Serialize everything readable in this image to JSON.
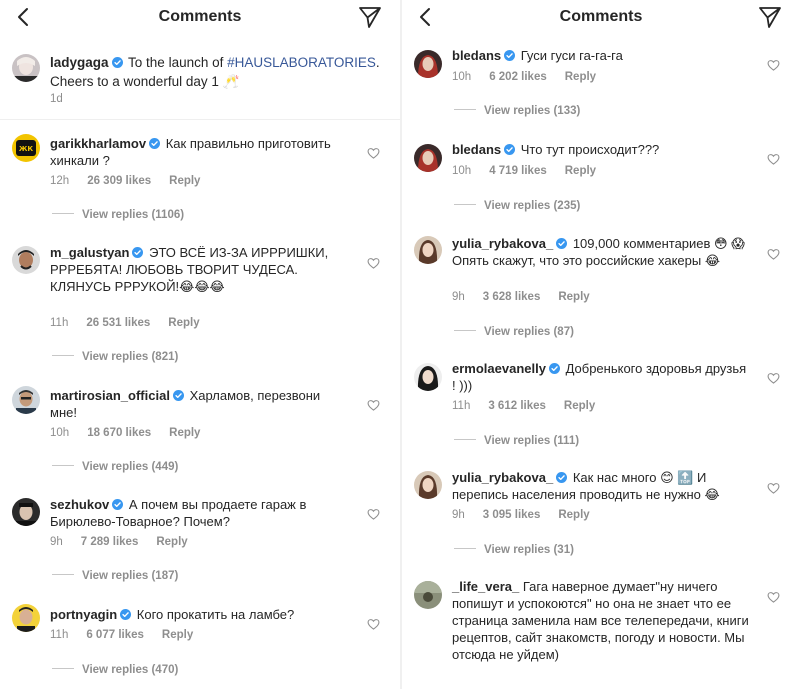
{
  "left": {
    "header": {
      "title": "Comments",
      "back_icon": "back-chevron-icon",
      "send_icon": "direct-send-icon"
    },
    "caption": {
      "username": "ladygaga",
      "text_before": " To the launch of ",
      "hashtag": "#HAUSLABORATORIES",
      "text_after": ". Cheers to a wonderful day 1 🥂",
      "time": "1d"
    },
    "comments": [
      {
        "username": "garikkharlamov",
        "text": "Как правильно приготовить хинкали ?",
        "time": "12h",
        "likes": "26 309 likes",
        "reply": "Reply",
        "view_replies": "View replies (1106)"
      },
      {
        "username": "m_galustyan",
        "text": "ЭТО ВСЁ ИЗ-ЗА ИРРРИШКИ, РРРЕБЯТА! ЛЮБОВЬ ТВОРИТ ЧУДЕСА. КЛЯНУСЬ РРРУКОЙ!😂😂😂",
        "time": "11h",
        "likes": "26 531 likes",
        "reply": "Reply",
        "view_replies": "View replies (821)"
      },
      {
        "username": "martirosian_official",
        "text": "Харламов, перезвони мне!",
        "time": "10h",
        "likes": "18 670 likes",
        "reply": "Reply",
        "view_replies": "View replies (449)"
      },
      {
        "username": "sezhukov",
        "text": "А почем вы продаете гараж в Бирюлево-Товарное? Почем?",
        "time": "9h",
        "likes": "7 289 likes",
        "reply": "Reply",
        "view_replies": "View replies (187)"
      },
      {
        "username": "portnyagin",
        "text": "Кого прокатить на ламбе?",
        "time": "11h",
        "likes": "6 077 likes",
        "reply": "Reply",
        "view_replies": "View replies (470)"
      }
    ]
  },
  "right": {
    "header": {
      "title": "Comments",
      "back_icon": "back-chevron-icon",
      "send_icon": "direct-send-icon"
    },
    "comments": [
      {
        "username": "bledans",
        "text": "Гуси гуси га-га-га",
        "time": "10h",
        "likes": "6 202 likes",
        "reply": "Reply",
        "view_replies": "View replies (133)"
      },
      {
        "username": "bledans",
        "text": "Что тут происходит???",
        "time": "10h",
        "likes": "4 719 likes",
        "reply": "Reply",
        "view_replies": "View replies (235)"
      },
      {
        "username": "yulia_rybakova_",
        "text": "109,000 комментариев 😳 😱 Опять скажут, что это российские хакеры 😂",
        "time": "9h",
        "likes": "3 628 likes",
        "reply": "Reply",
        "view_replies": "View replies (87)"
      },
      {
        "username": "ermolaevanelly",
        "text": "Добренького здоровья друзья ! )))",
        "time": "11h",
        "likes": "3 612 likes",
        "reply": "Reply",
        "view_replies": "View replies (111)"
      },
      {
        "username": "yulia_rybakova_",
        "text": "Как нас много 😊 🔝 И перепись населения проводить не нужно 😂",
        "time": "9h",
        "likes": "3 095 likes",
        "reply": "Reply",
        "view_replies": "View replies (31)"
      },
      {
        "username": "_life_vera_",
        "text": "Гага наверное думает\"ну ничего попишут и успокоются\" но она не знает что ее страница заменила нам все телепередачи, книги рецептов, сайт знакомств, погоду и новости. Мы отсюда не уйдем)"
      }
    ]
  },
  "colors": {
    "text": "#262626",
    "muted": "#8e8e8e",
    "verified": "#3897f0",
    "hashtag": "#385898",
    "separator": "#efefef"
  }
}
